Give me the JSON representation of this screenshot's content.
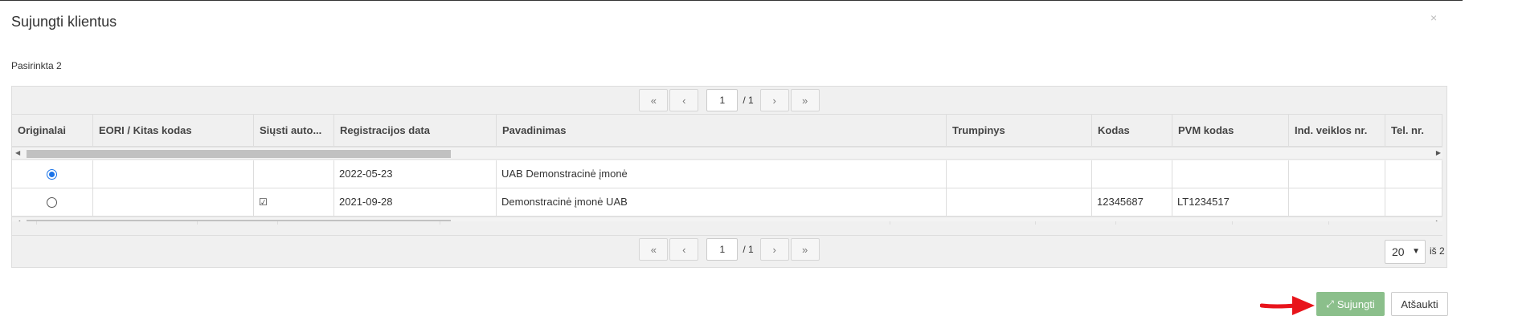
{
  "dialog": {
    "title": "Sujungti klientus",
    "close_glyph": "×",
    "selected_label": "Pasirinkta 2"
  },
  "pager": {
    "first": "«",
    "prev": "‹",
    "page": "1",
    "total": "/ 1",
    "next": "›",
    "last": "»"
  },
  "table": {
    "columns": [
      "Originalai",
      "EORI / Kitas kodas",
      "Siųsti auto...",
      "Registracijos data",
      "Pavadinimas",
      "Trumpinys",
      "Kodas",
      "PVM kodas",
      "Ind. veiklos nr.",
      "Tel. nr."
    ],
    "rows": [
      {
        "original_selected": true,
        "eori": "",
        "auto": "",
        "reg_date": "2022-05-23",
        "name": "UAB Demonstracinė įmonė",
        "short": "",
        "code": "",
        "vat": "",
        "ind": "",
        "tel": ""
      },
      {
        "original_selected": false,
        "eori": "",
        "auto": "☑",
        "reg_date": "2021-09-28",
        "name": "Demonstracinė įmonė UAB",
        "short": "",
        "code": "12345687",
        "vat": "LT1234517",
        "ind": "",
        "tel": ""
      }
    ],
    "scroll_left_glyph": "◀",
    "scroll_right_glyph": "▶"
  },
  "page_size": {
    "selected": "20",
    "of_label": "iš 2"
  },
  "buttons": {
    "merge_label": "Sujungti",
    "merge_icon": "compress-icon",
    "cancel_label": "Atšaukti"
  },
  "colors": {
    "merge_button": "#8bbf8b",
    "radio_accent": "#1a73e8",
    "pointer_arrow": "#e8141b"
  }
}
